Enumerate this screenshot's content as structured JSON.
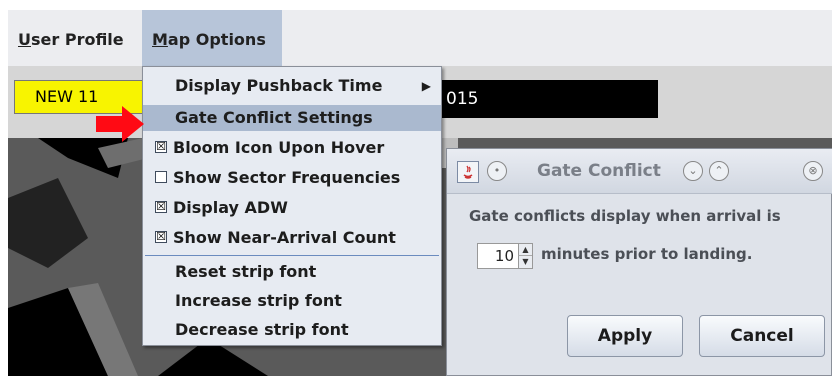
{
  "menubar": {
    "items": [
      {
        "mnemonic": "U",
        "rest": "ser Profile"
      },
      {
        "mnemonic": "M",
        "rest": "ap Options"
      }
    ]
  },
  "strip": {
    "new_label": "NEW  11",
    "field_text": "015"
  },
  "map_options_menu": {
    "items": [
      {
        "label": "Display Pushback Time",
        "has_submenu": true
      },
      {
        "label": "Gate Conflict Settings",
        "highlighted": true
      },
      {
        "label": "Bloom Icon Upon Hover",
        "checked": true
      },
      {
        "label": "Show Sector Frequencies",
        "checked": false
      },
      {
        "label": "Display ADW",
        "checked": true
      },
      {
        "label": "Show Near-Arrival Count",
        "checked": true
      },
      {
        "label": "Reset strip font"
      },
      {
        "label": "Increase strip font"
      },
      {
        "label": "Decrease strip font"
      }
    ],
    "check_mark": "☒"
  },
  "dialog": {
    "title": "Gate Conflict",
    "message": "Gate conflicts display when arrival is",
    "minutes_value": "10",
    "after_spinner": "minutes prior to landing.",
    "apply_label": "Apply",
    "cancel_label": "Cancel"
  },
  "icons": {
    "submenu_arrow": "▶",
    "spinner_up": "▲",
    "spinner_down": "▼",
    "minimize": "⌄",
    "maximize": "⌃",
    "close": "⊗",
    "menu_btn": "•"
  },
  "colors": {
    "accent_arrow": "#ff0a14",
    "highlight": "#aab9cf",
    "new_box": "#f8f400"
  }
}
